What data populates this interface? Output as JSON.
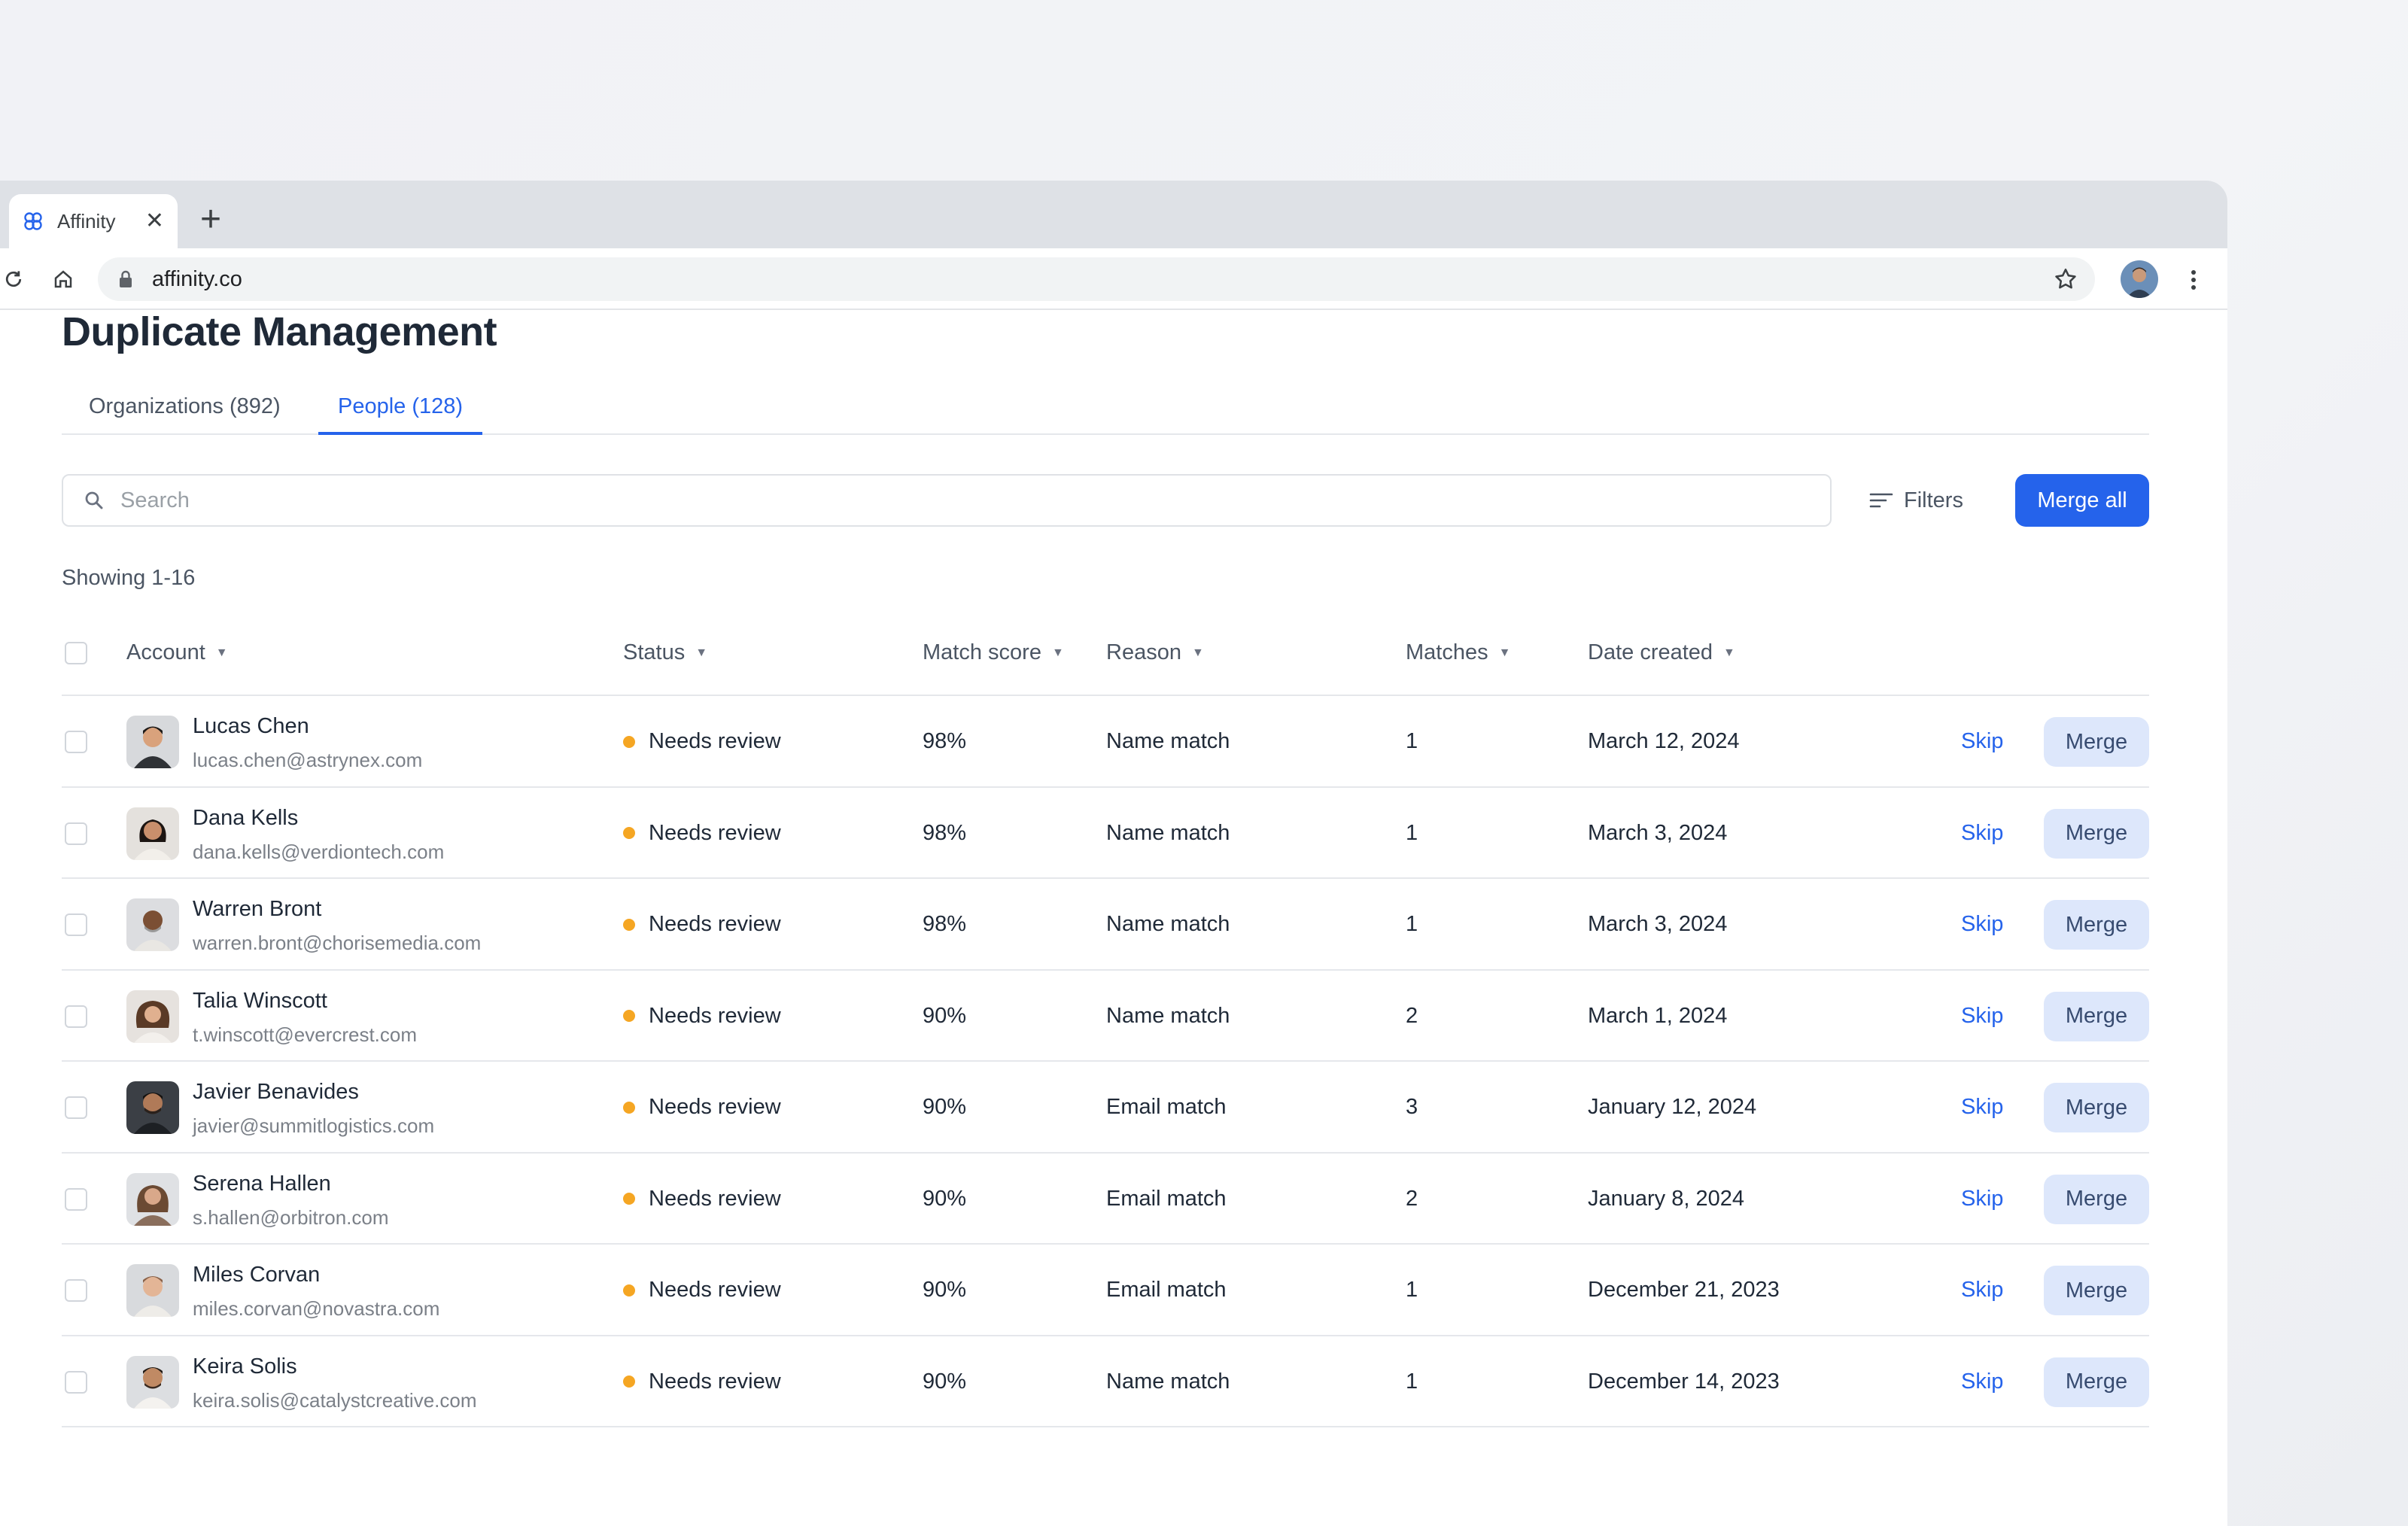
{
  "browser": {
    "tab_title": "Affinity",
    "url": "affinity.co"
  },
  "page": {
    "title": "Duplicate Management",
    "tabs": [
      {
        "label": "Organizations (892)",
        "active": false
      },
      {
        "label": "People (128)",
        "active": true
      }
    ],
    "search_placeholder": "Search",
    "filters_label": "Filters",
    "merge_all_label": "Merge all",
    "showing_text": "Showing 1-16"
  },
  "table": {
    "columns": [
      "Account",
      "Status",
      "Match score",
      "Reason",
      "Matches",
      "Date created"
    ],
    "skip_label": "Skip",
    "merge_label": "Merge",
    "rows": [
      {
        "name": "Lucas Chen",
        "email": "lucas.chen@astrynex.com",
        "status": "Needs review",
        "score": "98%",
        "reason": "Name match",
        "matches": "1",
        "date": "March 12, 2024"
      },
      {
        "name": "Dana Kells",
        "email": "dana.kells@verdiontech.com",
        "status": "Needs review",
        "score": "98%",
        "reason": "Name match",
        "matches": "1",
        "date": "March 3, 2024"
      },
      {
        "name": "Warren Bront",
        "email": "warren.bront@chorisemedia.com",
        "status": "Needs review",
        "score": "98%",
        "reason": "Name match",
        "matches": "1",
        "date": "March 3, 2024"
      },
      {
        "name": "Talia Winscott",
        "email": "t.winscott@evercrest.com",
        "status": "Needs review",
        "score": "90%",
        "reason": "Name match",
        "matches": "2",
        "date": "March 1, 2024"
      },
      {
        "name": "Javier Benavides",
        "email": "javier@summitlogistics.com",
        "status": "Needs review",
        "score": "90%",
        "reason": "Email match",
        "matches": "3",
        "date": "January 12, 2024"
      },
      {
        "name": "Serena Hallen",
        "email": "s.hallen@orbitron.com",
        "status": "Needs review",
        "score": "90%",
        "reason": "Email match",
        "matches": "2",
        "date": "January 8, 2024"
      },
      {
        "name": "Miles Corvan",
        "email": "miles.corvan@novastra.com",
        "status": "Needs review",
        "score": "90%",
        "reason": "Email match",
        "matches": "1",
        "date": "December 21, 2023"
      },
      {
        "name": "Keira Solis",
        "email": "keira.solis@catalystcreative.com",
        "status": "Needs review",
        "score": "90%",
        "reason": "Name match",
        "matches": "1",
        "date": "December 14, 2023"
      }
    ]
  },
  "colors": {
    "accent": "#2563eb",
    "status_needs_review": "#f5a623",
    "merge_button_bg": "#dde7fb"
  }
}
